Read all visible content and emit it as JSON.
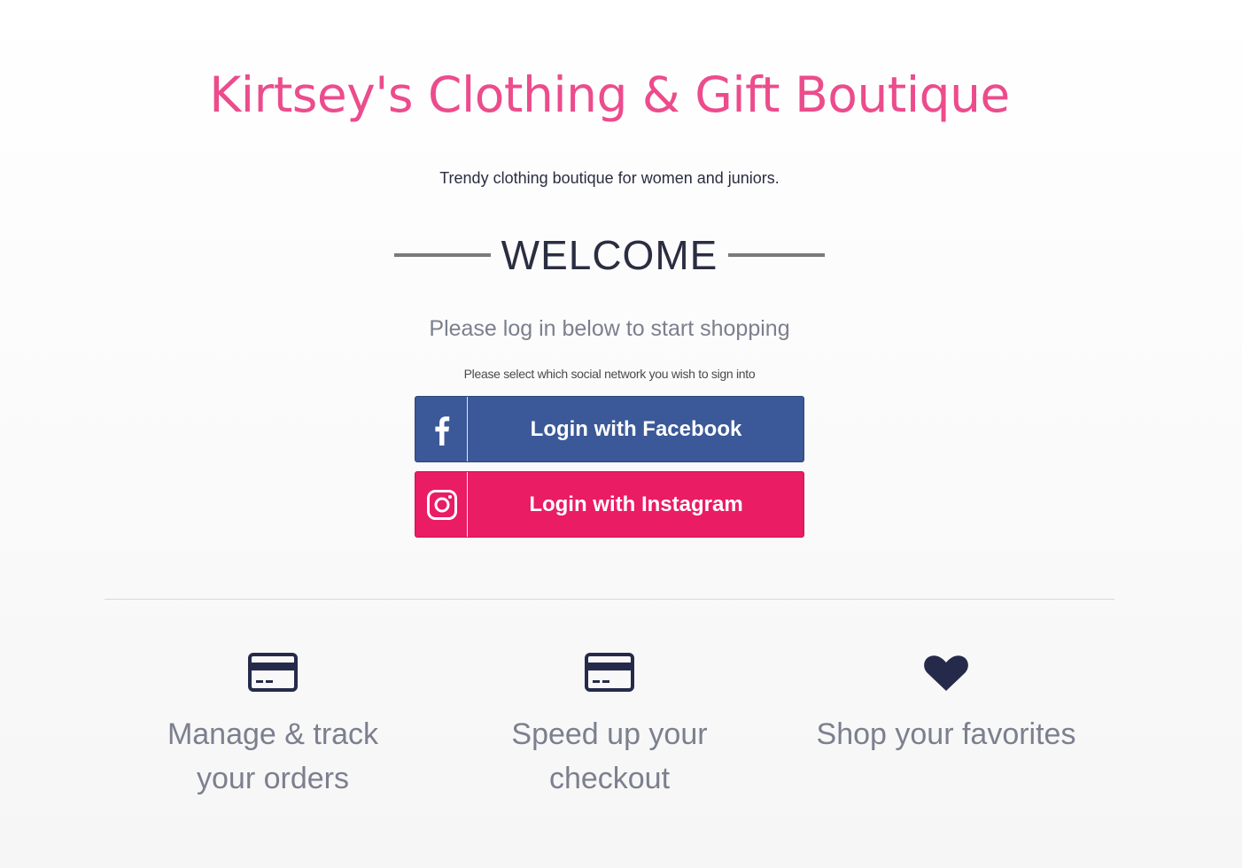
{
  "header": {
    "store_title": "Kirtsey's Clothing & Gift Boutique",
    "tagline": "Trendy clothing boutique for women and juniors."
  },
  "welcome": {
    "heading": "WELCOME",
    "prompt": "Please log in below to start shopping",
    "select_note": "Please select which social network you wish to sign into"
  },
  "login": {
    "facebook_label": "Login with Facebook",
    "instagram_label": "Login with Instagram",
    "facebook_icon": "facebook-icon",
    "instagram_icon": "instagram-icon"
  },
  "features": [
    {
      "icon": "credit-card-icon",
      "text": "Manage & track your orders"
    },
    {
      "icon": "credit-card-icon",
      "text": "Speed up your checkout"
    },
    {
      "icon": "heart-icon",
      "text": "Shop your favorites"
    }
  ],
  "colors": {
    "title_pink": "#ec4c8c",
    "facebook_blue": "#3b5998",
    "instagram_pink": "#ea1c63",
    "navy_icon": "#262a4a"
  }
}
